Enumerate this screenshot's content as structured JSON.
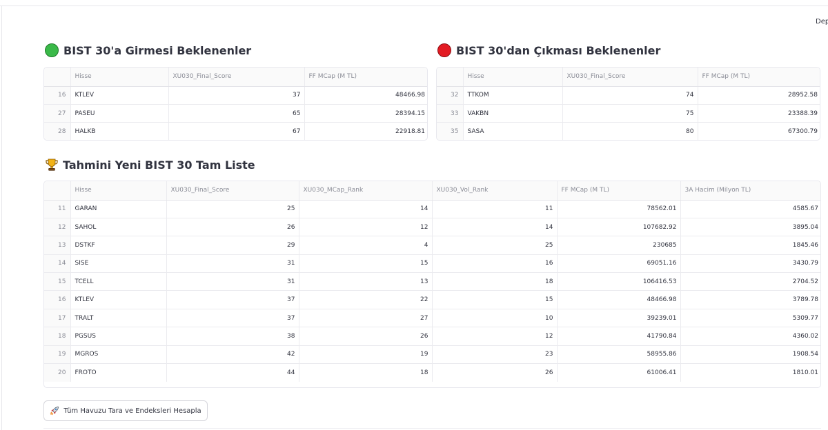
{
  "header": {
    "deploy_label": "Dep"
  },
  "enter_section": {
    "title": "BIST 30'a Girmesi Beklenenler",
    "columns": [
      "",
      "Hisse",
      "XU030_Final_Score",
      "FF MCap (M TL)"
    ],
    "rows": [
      [
        "16",
        "KTLEV",
        "37",
        "48466.98"
      ],
      [
        "27",
        "PASEU",
        "65",
        "28394.15"
      ],
      [
        "28",
        "HALKB",
        "67",
        "22918.81"
      ]
    ]
  },
  "exit_section": {
    "title": "BIST 30'dan Çıkması Beklenenler",
    "columns": [
      "",
      "Hisse",
      "XU030_Final_Score",
      "FF MCap (M TL)"
    ],
    "rows": [
      [
        "32",
        "TTKOM",
        "74",
        "28952.58"
      ],
      [
        "33",
        "VAKBN",
        "75",
        "23388.39"
      ],
      [
        "35",
        "SASA",
        "80",
        "67300.79"
      ]
    ]
  },
  "full_list": {
    "title": "Tahmini Yeni BIST 30 Tam Liste",
    "columns": [
      "",
      "Hisse",
      "XU030_Final_Score",
      "XU030_MCap_Rank",
      "XU030_Vol_Rank",
      "FF MCap (M TL)",
      "3A Hacim (Milyon TL)"
    ],
    "rows": [
      [
        "11",
        "GARAN",
        "25",
        "14",
        "11",
        "78562.01",
        "4585.67"
      ],
      [
        "12",
        "SAHOL",
        "26",
        "12",
        "14",
        "107682.92",
        "3895.04"
      ],
      [
        "13",
        "DSTKF",
        "29",
        "4",
        "25",
        "230685",
        "1845.46"
      ],
      [
        "14",
        "SISE",
        "31",
        "15",
        "16",
        "69051.16",
        "3430.79"
      ],
      [
        "15",
        "TCELL",
        "31",
        "13",
        "18",
        "106416.53",
        "2704.52"
      ],
      [
        "16",
        "KTLEV",
        "37",
        "22",
        "15",
        "48466.98",
        "3789.78"
      ],
      [
        "17",
        "TRALT",
        "37",
        "27",
        "10",
        "39239.01",
        "5309.77"
      ],
      [
        "18",
        "PGSUS",
        "38",
        "26",
        "12",
        "41790.84",
        "4360.02"
      ],
      [
        "19",
        "MGROS",
        "42",
        "19",
        "23",
        "58955.86",
        "1908.54"
      ],
      [
        "20",
        "FROTO",
        "44",
        "18",
        "26",
        "61006.41",
        "1810.01"
      ]
    ]
  },
  "action_button": {
    "label": "Tüm Havuzu Tara ve Endeksleri Hesapla",
    "icon": "rocket-icon"
  },
  "colors": {
    "green_status": "#3ab949",
    "red_status": "#e31b23",
    "trophy": "#f2b215"
  }
}
